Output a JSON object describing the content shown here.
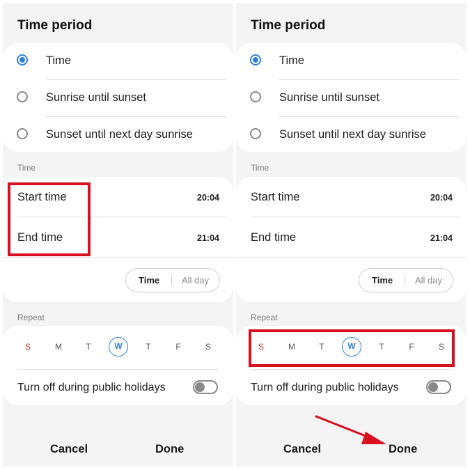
{
  "panels": [
    {
      "title": "Time period",
      "options": [
        "Time",
        "Sunrise until sunset",
        "Sunset until next day sunrise"
      ],
      "selected_option": "Time",
      "time_section_label": "Time",
      "start_time_label": "Start time",
      "start_time_value": "20:04",
      "end_time_label": "End time",
      "end_time_value": "21:04",
      "segment_time": "Time",
      "segment_allday": "All day",
      "repeat_label": "Repeat",
      "days": [
        "S",
        "M",
        "T",
        "W",
        "T",
        "F",
        "S"
      ],
      "selected_day": "W",
      "holidays_label": "Turn off during public holidays",
      "holidays_toggle": false,
      "cancel_label": "Cancel",
      "done_label": "Done"
    },
    {
      "title": "Time period",
      "options": [
        "Time",
        "Sunrise until sunset",
        "Sunset until next day sunrise"
      ],
      "selected_option": "Time",
      "time_section_label": "Time",
      "start_time_label": "Start time",
      "start_time_value": "20:04",
      "end_time_label": "End time",
      "end_time_value": "21:04",
      "segment_time": "Time",
      "segment_allday": "All day",
      "repeat_label": "Repeat",
      "days": [
        "S",
        "M",
        "T",
        "W",
        "T",
        "F",
        "S"
      ],
      "selected_day": "W",
      "holidays_label": "Turn off during public holidays",
      "holidays_toggle": false,
      "cancel_label": "Cancel",
      "done_label": "Done"
    }
  ],
  "colors": {
    "accent": "#2f80d8",
    "highlight": "#d6101f",
    "sunday": "#c0392b",
    "panel_background": "#f4f4f4"
  }
}
